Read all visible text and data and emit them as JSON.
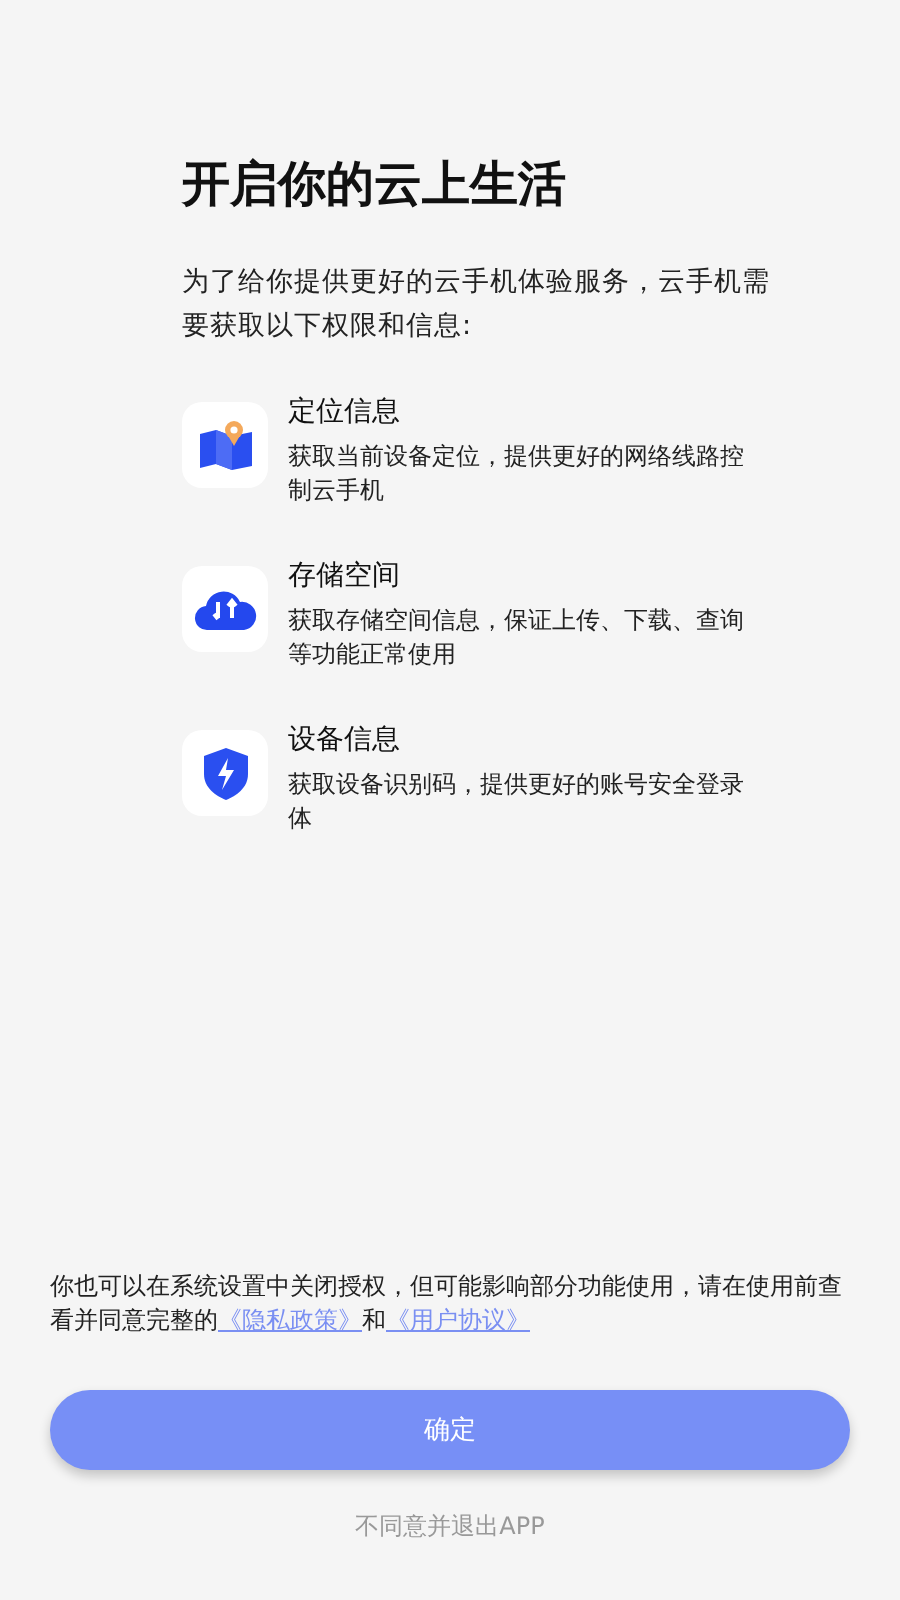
{
  "title": "开启你的云上生活",
  "intro": "为了给你提供更好的云手机体验服务，云手机需要获取以下权限和信息:",
  "permissions": [
    {
      "kind": "location",
      "name": "定位信息",
      "description": "获取当前设备定位，提供更好的网络线路控制云手机"
    },
    {
      "kind": "storage",
      "name": "存储空间",
      "description": "获取存储空间信息，保证上传、下载、查询等功能正常使用"
    },
    {
      "kind": "device",
      "name": "设备信息",
      "description": "获取设备识别码，提供更好的账号安全登录体"
    }
  ],
  "notice": {
    "text": "你也可以在系统设置中关闭授权，但可能影响部分功能使用，请在使用前查看并同意完整的",
    "privacy_link": "《隐私政策》",
    "conjunction": "和",
    "agreement_link": "《用户协议》"
  },
  "confirm_button": "确定",
  "decline_link": "不同意并退出APP"
}
